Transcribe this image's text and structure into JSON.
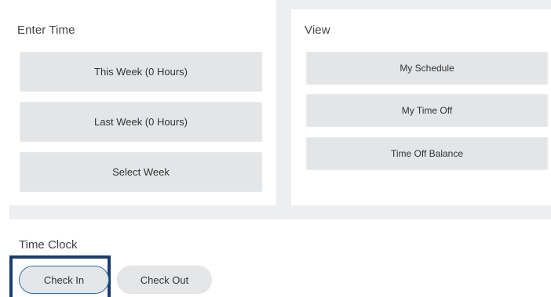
{
  "enter_time": {
    "title": "Enter Time",
    "this_week_label": "This Week (0 Hours)",
    "last_week_label": "Last Week (0 Hours)",
    "select_week_label": "Select Week"
  },
  "view": {
    "title": "View",
    "my_schedule_label": "My Schedule",
    "my_time_off_label": "My Time Off",
    "time_off_balance_label": "Time Off Balance"
  },
  "time_clock": {
    "title": "Time Clock",
    "check_in_label": "Check In",
    "check_out_label": "Check Out"
  },
  "colors": {
    "highlight_border": "#1a3d6e",
    "tile_background": "#e3e5e7",
    "page_band": "#edeef0"
  }
}
